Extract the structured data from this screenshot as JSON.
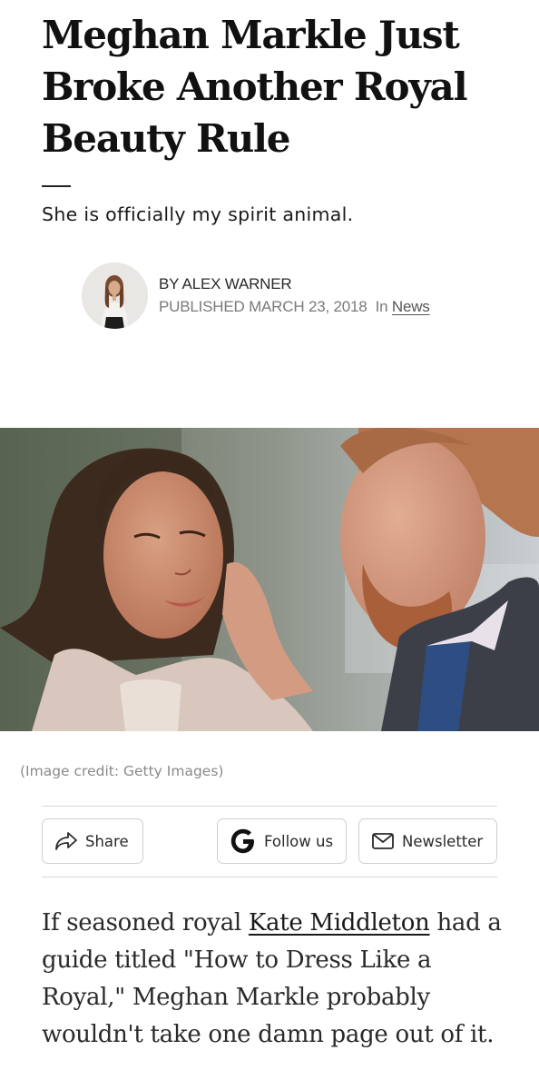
{
  "article": {
    "headline": "Meghan Markle Just Broke Another Royal Beauty Rule",
    "dek": "She is officially my spirit animal.",
    "byline": {
      "author": "BY ALEX WARNER",
      "published": "PUBLISHED MARCH 23, 2018",
      "category_prefix": "In",
      "category": "News"
    },
    "image_credit": "(Image credit: Getty Images)",
    "body": {
      "before_link": "If seasoned royal ",
      "link_text": "Kate Middleton",
      "after_link": " had a guide titled \"How to Dress Like a Royal,\" Meghan Markle probably wouldn't take one damn page out of it."
    }
  },
  "actions": {
    "share": "Share",
    "follow": "Follow us",
    "newsletter": "Newsletter"
  },
  "icons": {
    "share": "share-arrow-icon",
    "follow": "google-g-icon",
    "newsletter": "envelope-icon"
  }
}
